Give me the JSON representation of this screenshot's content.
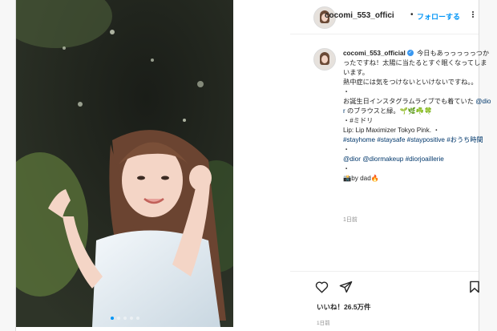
{
  "post": {
    "username": "cocomi_553_official",
    "header_username": "cocomi_553_offici",
    "header_separator": "•",
    "follow_label": "フォローする",
    "caption": {
      "intro": " 今日もあっっっっっつかったですね！太陽に当たるとすぐ眠くなってしまいます。\n熱中症には気をつけないといけないですね。。\n・\nお誕生日インスタグラムライブでも着ていた ",
      "mention_dior": "@dior",
      "after_dior": " のブラウスと緑。🌱🌿☘️🍀\n・#ミドリ\nLip: Lip Maximizer Tokyo Pink. ・\n",
      "hashtags": "#stayhome #staysafe #staypositive #おうち時間",
      "mid_dot": "\n・\n",
      "mentions_2": "@dior @diormakeup #diorjoaillerie",
      "end_dot": "\n・\n",
      "credit": "📸by dad🔥"
    },
    "caption_time": "1日前",
    "likes": "いいね！26.5万件",
    "timestamp": "1日前"
  },
  "colors": {
    "link": "#00376b",
    "follow": "#0095f6",
    "verified": "#3897f0"
  },
  "icons": [
    "heart-icon",
    "share-icon",
    "bookmark-icon",
    "more-icon",
    "verified-icon"
  ]
}
